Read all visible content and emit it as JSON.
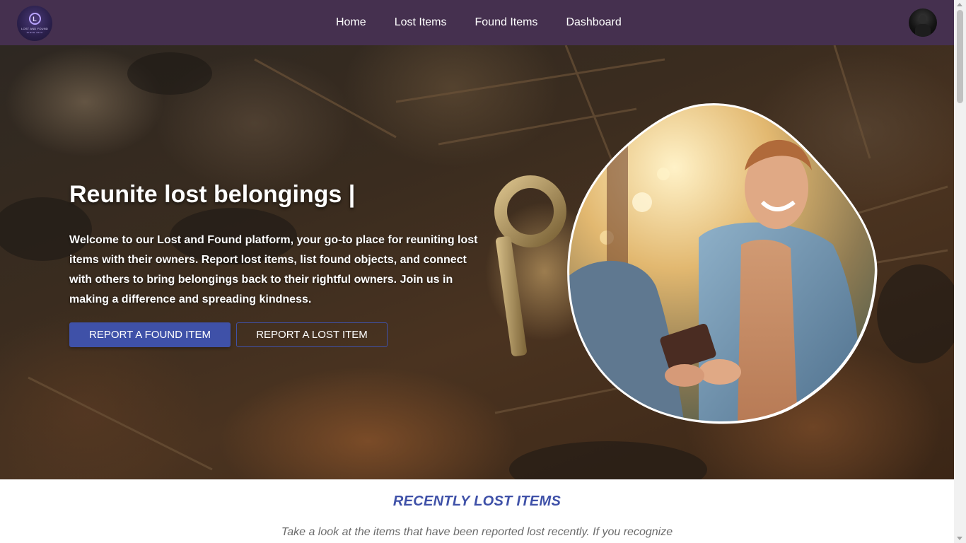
{
  "navbar": {
    "logo": {
      "mark": "L",
      "text": "LOST AND FOUND",
      "subtext": "SINCE 2023"
    },
    "links": [
      "Home",
      "Lost Items",
      "Found Items",
      "Dashboard"
    ],
    "colors": {
      "background": "#45304f"
    }
  },
  "hero": {
    "title": "Reunite lost belongings |",
    "description": "Welcome to our Lost and Found platform, your go-to place for reuniting lost items with their owners. Report lost items, list found objects, and connect with others to bring belongings back to their rightful owners. Join us in making a difference and spreading kindness.",
    "buttons": {
      "found": "REPORT A FOUND ITEM",
      "lost": "REPORT A LOST ITEM"
    },
    "colors": {
      "button_primary": "#3f51a8"
    }
  },
  "recent_lost": {
    "title": "RECENTLY LOST ITEMS",
    "description": "Take a look at the items that have been reported lost recently. If you recognize"
  }
}
